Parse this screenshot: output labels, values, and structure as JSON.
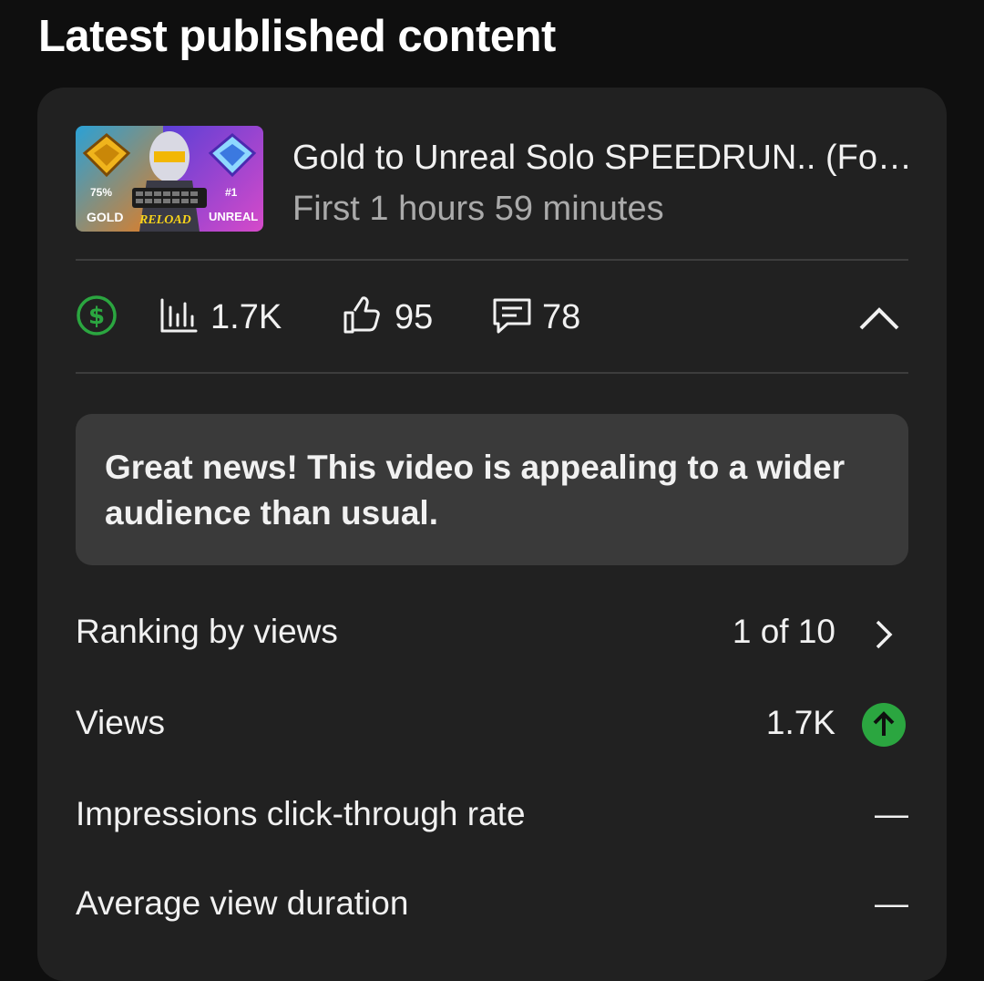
{
  "section": {
    "title": "Latest published content"
  },
  "video": {
    "title": "Gold to Unreal Solo SPEEDRUN.. (Fo…",
    "subtitle": "First 1 hours 59 minutes",
    "thumbnail_text": {
      "left_percent": "75%",
      "left_label": "GOLD",
      "center_label": "RELOAD",
      "right_rank": "#1",
      "right_label": "UNREAL"
    }
  },
  "stats": {
    "monetization_icon": "dollar-circle-icon",
    "views": "1.7K",
    "likes": "95",
    "comments": "78"
  },
  "callout": {
    "text": "Great news! This video is appealing to a wider audience than usual."
  },
  "metrics": [
    {
      "label": "Ranking by views",
      "value": "1 of 10",
      "icon": "chevron-right-icon"
    },
    {
      "label": "Views",
      "value": "1.7K",
      "icon": "arrow-up-circle-icon"
    },
    {
      "label": "Impressions click-through rate",
      "value": "—"
    },
    {
      "label": "Average view duration",
      "value": "—"
    }
  ],
  "colors": {
    "positive": "#2ba640",
    "card": "#212121",
    "callout": "#3a3a3a"
  }
}
